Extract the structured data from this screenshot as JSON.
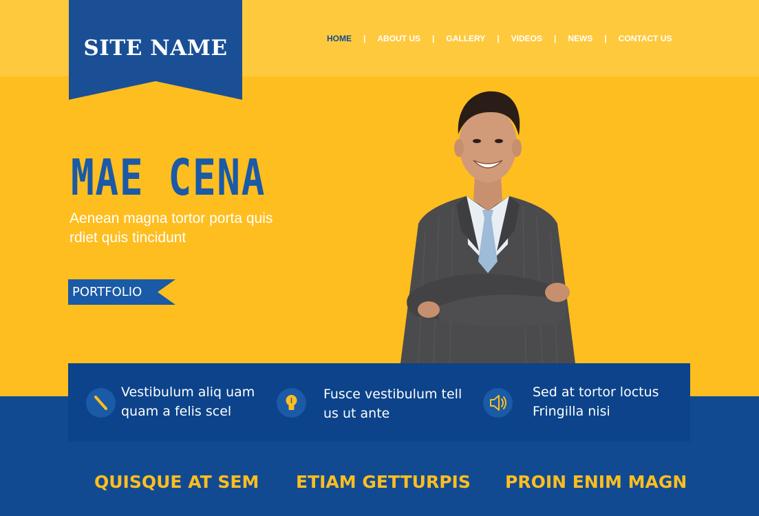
{
  "site": {
    "name": "SITE NAME"
  },
  "nav": {
    "items": [
      {
        "label": "HOME",
        "active": true
      },
      {
        "label": "ABOUT US",
        "active": false
      },
      {
        "label": "GALLERY",
        "active": false
      },
      {
        "label": "VIDEOS",
        "active": false
      },
      {
        "label": "NEWS",
        "active": false
      },
      {
        "label": "CONTACT US",
        "active": false
      }
    ],
    "separator": "|"
  },
  "hero": {
    "title": "MAE CENA",
    "subtitle_line1": "Aenean magna tortor porta quis",
    "subtitle_line2": "rdiet quis tincidunt",
    "button_label": "PORTFOLIO"
  },
  "features": [
    {
      "icon": "pencil-icon",
      "line1": "Vestibulum aliq uam",
      "line2": "quam a felis scel"
    },
    {
      "icon": "lightbulb-icon",
      "line1": "Fusce vestibulum tell",
      "line2": "us ut ante"
    },
    {
      "icon": "speaker-icon",
      "line1": "Sed at tortor loctus",
      "line2": "Fringilla nisi"
    }
  ],
  "columns": [
    {
      "title": "QUISQUE AT SEM"
    },
    {
      "title": "ETIAM GETTURPIS"
    },
    {
      "title": "PROIN ENIM MAGN"
    }
  ],
  "colors": {
    "yellow": "#ffbe1f",
    "header_yellow": "#ffc93d",
    "blue": "#124a92",
    "dark_blue": "#0c438a",
    "title_blue": "#1a5aa6",
    "white": "#ffffff"
  }
}
